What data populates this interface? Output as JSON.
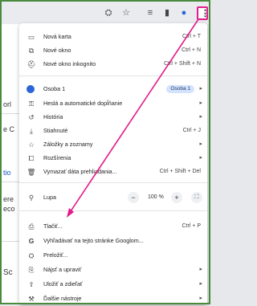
{
  "colors": {
    "accent": "#e11d8b",
    "profile": "#2b63d9",
    "badge": "#d3e3fd"
  },
  "toolbar": {
    "icons": [
      "translate-icon",
      "star-icon",
      "reading-list-icon",
      "side-panel-icon",
      "profile-icon",
      "more-icon"
    ]
  },
  "background_fragments": [
    "orl",
    "e C",
    "tio",
    "ere",
    "eco",
    "Sc"
  ],
  "menu": {
    "new_tab": {
      "label": "Nová karta",
      "shortcut": "Ctrl + T"
    },
    "new_window": {
      "label": "Nové okno",
      "shortcut": "Ctrl + N"
    },
    "incognito": {
      "label": "Nové okno inkognito",
      "shortcut": "Ctrl + Shift + N"
    },
    "profile": {
      "label": "Osoba 1",
      "badge": "Osoba 1"
    },
    "passwords": {
      "label": "Heslá a automatické dopĺňanie"
    },
    "history": {
      "label": "História"
    },
    "downloads": {
      "label": "Stiahnuté",
      "shortcut": "Ctrl + J"
    },
    "bookmarks": {
      "label": "Záložky a zoznamy"
    },
    "extensions": {
      "label": "Rozšírenia"
    },
    "clear_data": {
      "label": "Vymazať dáta prehliadania...",
      "shortcut": "Ctrl + Shift + Del"
    },
    "zoom": {
      "label": "Lupa",
      "minus": "−",
      "value": "100 %",
      "plus": "+"
    },
    "print": {
      "label": "Tlačiť...",
      "shortcut": "Ctrl + P"
    },
    "search_google": {
      "label": "Vyhľadávať na tejto stránke Googlom..."
    },
    "translate": {
      "label": "Preložiť..."
    },
    "find_edit": {
      "label": "Nájsť a upraviť"
    },
    "save_share": {
      "label": "Uložiť a zdieľať"
    },
    "more_tools": {
      "label": "Ďalšie nástroje"
    }
  }
}
